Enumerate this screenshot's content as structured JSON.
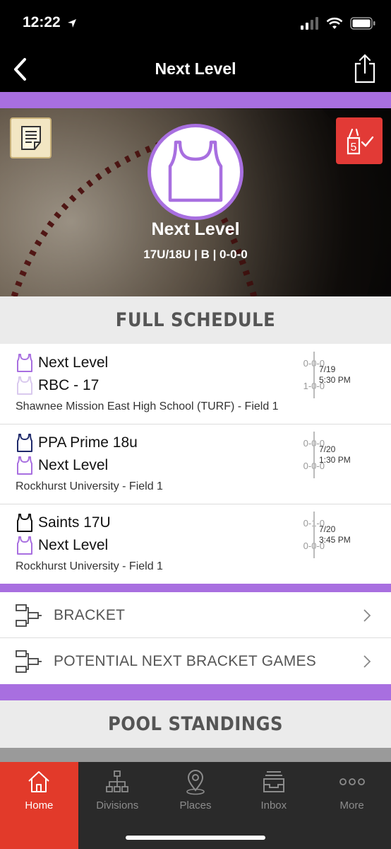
{
  "status_bar": {
    "time": "12:22"
  },
  "nav": {
    "title": "Next Level"
  },
  "colors": {
    "accent": "#a86fe0",
    "red": "#e23a2a",
    "tab_bg": "#2a2a2a"
  },
  "team": {
    "name": "Next Level",
    "subtitle": "17U/18U | B | 0-0-0",
    "checkin_count": "5"
  },
  "schedule": {
    "title": "FULL SCHEDULE",
    "games": [
      {
        "team1": {
          "name": "Next Level",
          "record": "0-0-0",
          "jersey_color": "#a86fe0"
        },
        "team2": {
          "name": "RBC - 17",
          "record": "1-0-0",
          "jersey_color": "#d9c9ee"
        },
        "date": "7/19",
        "time": "5:30 PM",
        "location": "Shawnee Mission East High School (TURF) - Field 1"
      },
      {
        "team1": {
          "name": "PPA Prime 18u",
          "record": "0-0-0",
          "jersey_color": "#1f2a6b"
        },
        "team2": {
          "name": "Next Level",
          "record": "0-0-0",
          "jersey_color": "#a86fe0"
        },
        "date": "7/20",
        "time": "1:30 PM",
        "location": "Rockhurst University - Field 1"
      },
      {
        "team1": {
          "name": "Saints 17U",
          "record": "0-1-0",
          "jersey_color": "#111111"
        },
        "team2": {
          "name": "Next Level",
          "record": "0-0-0",
          "jersey_color": "#a86fe0"
        },
        "date": "7/20",
        "time": "3:45 PM",
        "location": "Rockhurst University - Field 1"
      }
    ]
  },
  "bracket_links": [
    {
      "label": "BRACKET"
    },
    {
      "label": "POTENTIAL NEXT BRACKET GAMES"
    }
  ],
  "standings": {
    "title": "POOL STANDINGS"
  },
  "tabs": [
    {
      "label": "Home",
      "icon": "home-icon",
      "active": true
    },
    {
      "label": "Divisions",
      "icon": "divisions-icon",
      "active": false
    },
    {
      "label": "Places",
      "icon": "places-icon",
      "active": false
    },
    {
      "label": "Inbox",
      "icon": "inbox-icon",
      "active": false
    },
    {
      "label": "More",
      "icon": "more-icon",
      "active": false
    }
  ]
}
